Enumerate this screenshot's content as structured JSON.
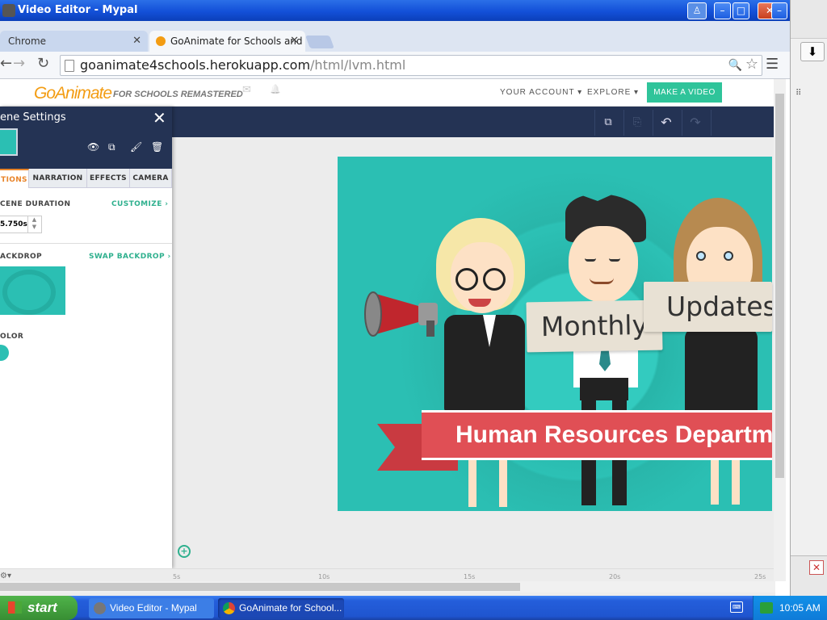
{
  "window": {
    "title": "Video Editor - Mypal",
    "controls": {
      "help": "♙",
      "minimize": "–",
      "maximize": "□",
      "close": "✕"
    }
  },
  "browser": {
    "tabs": [
      {
        "label": "Chrome",
        "close": "✕"
      },
      {
        "label": "GoAnimate for Schools and E",
        "close": "✕"
      }
    ],
    "url_host": "goanimate4schools.herokuapp.com",
    "url_path": "/html/lvm.html",
    "nav": {
      "back": "←",
      "forward": "→",
      "reload": "↻"
    },
    "zoom_icon": "🔍",
    "star_icon": "☆",
    "menu_icon": "☰"
  },
  "site": {
    "logo": "GoAnimate",
    "logo_sub": "FOR SCHOOLS REMASTERED",
    "nav": {
      "account": "YOUR ACCOUNT ▾",
      "explore": "EXPLORE ▾",
      "make_video": "MAKE A VIDEO"
    },
    "icons": {
      "mail": "✉",
      "bell": "🔔"
    }
  },
  "editor": {
    "toolbar_icons": {
      "copy": "⧉",
      "paste": "⎘",
      "undo": "↶",
      "redo": "↷"
    }
  },
  "panel": {
    "title": "ene Settings",
    "close": "✕",
    "icons": {
      "preview": "👁",
      "copy": "⧉",
      "brush": "🖌",
      "delete": "🗑"
    },
    "tabs": [
      "TIONS",
      "NARRATION",
      "EFFECTS",
      "CAMERA"
    ],
    "scene_duration_label": "CENE DURATION",
    "customize_link": "CUSTOMIZE ›",
    "duration_value": "5.750s",
    "backdrop_label": "ACKDROP",
    "swap_backdrop_link": "SWAP BACKDROP ›",
    "color_label": "OLOR"
  },
  "stage": {
    "sign_left": "Monthly",
    "sign_right": "Updates",
    "banner": "Human Resources Department"
  },
  "timeline": {
    "ticks": [
      "5s",
      "10s",
      "15s",
      "20s",
      "25s"
    ],
    "zoom_icon": "+"
  },
  "taskbar": {
    "start": "start",
    "tasks": [
      "Video Editor - Mypal",
      "GoAnimate for School..."
    ],
    "time": "10:05 AM"
  },
  "colors": {
    "accent": "#2fc49a",
    "navy": "#243354",
    "stage": "#2bbfb3",
    "banner": "#e04f55"
  }
}
